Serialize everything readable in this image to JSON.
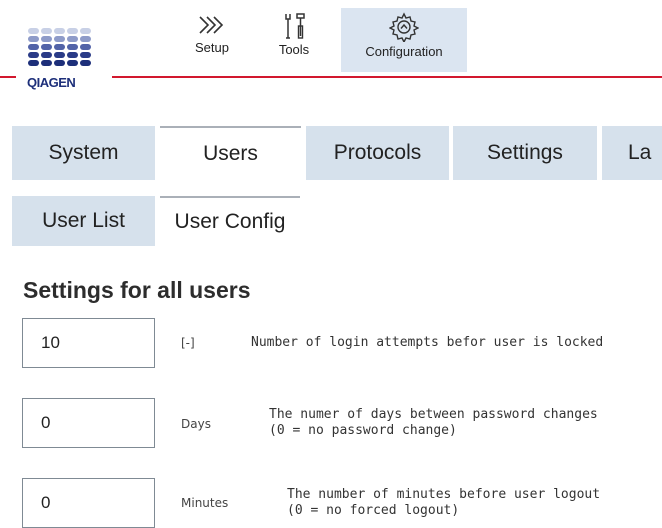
{
  "header": {
    "logo_text": "QIAGEN",
    "brand_color": "#1d2f7a",
    "accent_color": "#d2182e",
    "nav": [
      {
        "label": "Setup",
        "icon": "chevrons-right-icon"
      },
      {
        "label": "Tools",
        "icon": "wrench-screwdriver-icon"
      },
      {
        "label": "Configuration",
        "icon": "gear-icon",
        "active": true
      }
    ]
  },
  "tabs": [
    {
      "label": "System",
      "active": false
    },
    {
      "label": "Users",
      "active": true
    },
    {
      "label": "Protocols",
      "active": false
    },
    {
      "label": "Settings",
      "active": false
    },
    {
      "label": "La",
      "active": false
    }
  ],
  "subtabs": [
    {
      "label": "User List",
      "active": false
    },
    {
      "label": "User Config",
      "active": true
    }
  ],
  "section_title": "Settings for all users",
  "settings": [
    {
      "value": "10",
      "unit": "[-]",
      "description": "Number of login attempts befor user is locked",
      "description_line2": ""
    },
    {
      "value": "0",
      "unit": "Days",
      "description": "The numer of days between password changes",
      "description_line2": "(0 = no password change)"
    },
    {
      "value": "0",
      "unit": "Minutes",
      "description": "The number of minutes before user logout",
      "description_line2": "(0 = no forced logout)"
    }
  ]
}
